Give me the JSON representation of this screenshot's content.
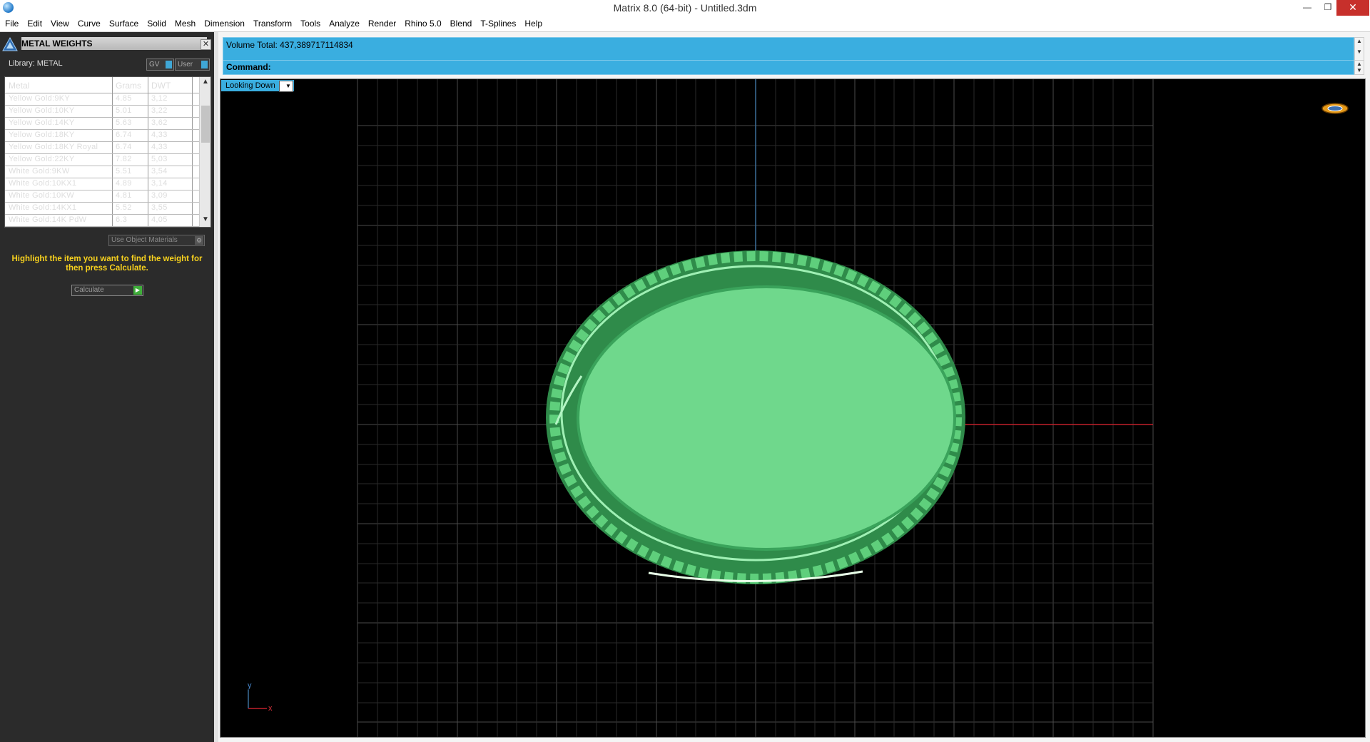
{
  "window": {
    "title": "Matrix 8.0 (64-bit) - Untitled.3dm",
    "minimize_glyph": "—",
    "maximize_glyph": "❐",
    "close_glyph": "✕"
  },
  "menu": [
    "File",
    "Edit",
    "View",
    "Curve",
    "Surface",
    "Solid",
    "Mesh",
    "Dimension",
    "Transform",
    "Tools",
    "Analyze",
    "Render",
    "Rhino 5.0",
    "Blend",
    "T-Splines",
    "Help"
  ],
  "panel": {
    "title": "METAL WEIGHTS",
    "close_glyph": "✕",
    "library_label": "Library: METAL",
    "gv_label": "GV",
    "user_label": "User",
    "columns": [
      "Metal",
      "Grams",
      "DWT"
    ],
    "rows": [
      [
        "Yellow Gold:9KY",
        "4.85",
        "3,12"
      ],
      [
        "Yellow Gold:10KY",
        "5.01",
        "3,22"
      ],
      [
        "Yellow Gold:14KY",
        "5.63",
        "3,62"
      ],
      [
        "Yellow Gold:18KY",
        "6.74",
        "4,33"
      ],
      [
        "Yellow Gold:18KY Royal",
        "6.74",
        "4,33"
      ],
      [
        "Yellow Gold:22KY",
        "7.82",
        "5,03"
      ],
      [
        "White Gold:9KW",
        "5.51",
        "3,54"
      ],
      [
        "White Gold:10KX1",
        "4.89",
        "3,14"
      ],
      [
        "White Gold:10KW",
        "4.81",
        "3,09"
      ],
      [
        "White Gold:14KX1",
        "5.52",
        "3,55"
      ],
      [
        "White Gold:14K PdW",
        "6.3",
        "4,05"
      ]
    ],
    "use_object_materials": "Use Object Materials",
    "hint": "Highlight the item you want to find the weight for then press Calculate.",
    "calculate_label": "Calculate"
  },
  "output": {
    "volume_text": "Volume Total: 437,389717114834",
    "command_label": "Command:"
  },
  "viewport": {
    "label": "Looking Down",
    "axis_y": "y",
    "axis_x": "x"
  },
  "colors": {
    "accent_blue": "#3aaee0",
    "panel_bg": "#2b2b2b",
    "hint_yellow": "#f7d11e",
    "model_green": "#6fd88c",
    "grid": "#4a4a4a",
    "x_axis": "#c0202a",
    "y_axis": "#3c6f9a"
  }
}
